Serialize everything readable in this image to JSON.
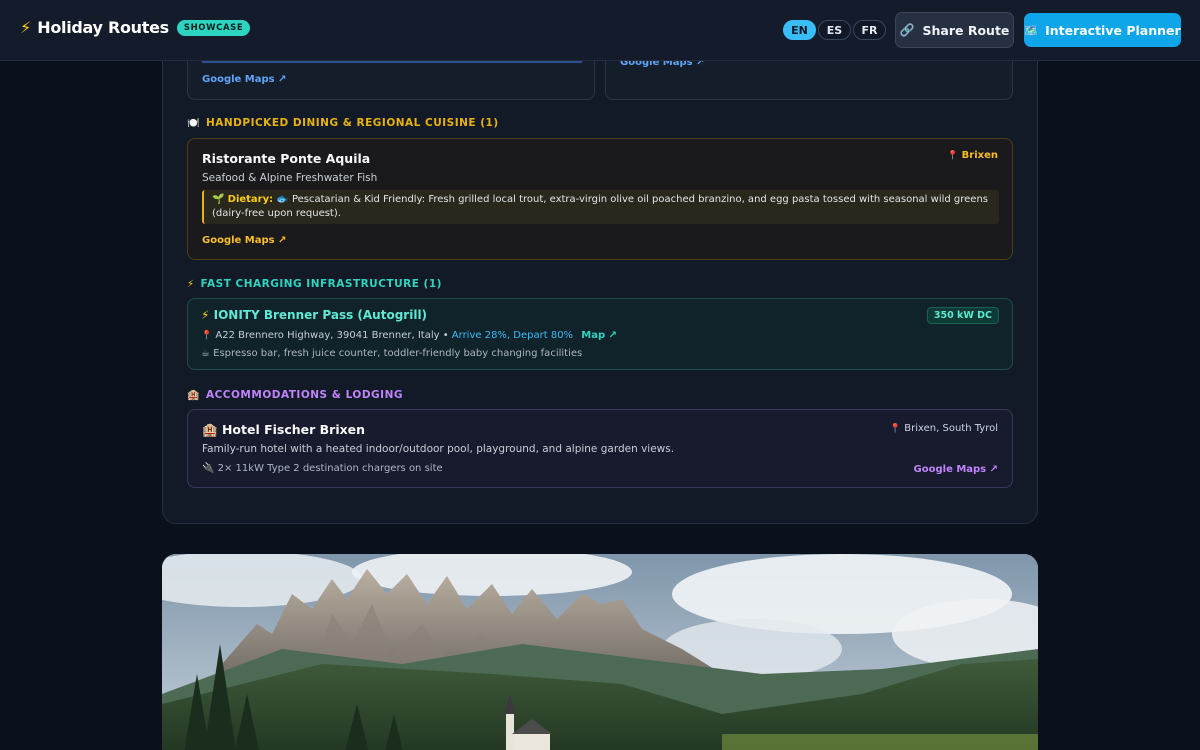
{
  "header": {
    "brand": "Holiday Routes",
    "badge": "SHOWCASE",
    "languages": [
      "EN",
      "ES",
      "FR"
    ],
    "active_language": "EN",
    "share_label": "Share Route",
    "planner_label": "Interactive Planner"
  },
  "top_cards": {
    "left_link": "Google Maps ↗",
    "right_link": "Google Maps ↗"
  },
  "dining": {
    "section_title": "HANDPICKED DINING & REGIONAL CUISINE (1)",
    "name": "Ristorante Ponte Aquila",
    "location": "Brixen",
    "cuisine": "Seafood & Alpine Freshwater Fish",
    "dietary_label": "Dietary:",
    "dietary_text": "Pescatarian & Kid Friendly: Fresh grilled local trout, extra-virgin olive oil poached branzino, and egg pasta tossed with seasonal wild greens (dairy-free upon request).",
    "maps_link": "Google Maps ↗"
  },
  "charging": {
    "section_title": "FAST CHARGING INFRASTRUCTURE (1)",
    "name": "IONITY Brenner Pass (Autogrill)",
    "power": "350 kW DC",
    "address": "A22 Brennero Highway, 39041 Brenner, Italy •",
    "soc": "Arrive 28%, Depart 80%",
    "map_link": "Map ↗",
    "amenities": "Espresso bar, fresh juice counter, toddler-friendly baby changing facilities"
  },
  "lodging": {
    "section_title": "ACCOMMODATIONS & LODGING",
    "name": "Hotel Fischer Brixen",
    "location": "Brixen, South Tyrol",
    "description": "Family-run hotel with a heated indoor/outdoor pool, playground, and alpine garden views.",
    "chargers": "2× 11kW Type 2 destination chargers on site",
    "maps_link": "Google Maps ↗"
  },
  "colors": {
    "accent_blue": "#38bdf8",
    "dining_gold": "#eab308",
    "charging_teal": "#2dd4bf",
    "lodging_purple": "#c084fc"
  },
  "icons": {
    "brand": "lightning-bolt-icon",
    "share": "link-icon",
    "planner": "map-icon",
    "dining": "plate-icon",
    "charging": "lightning-bolt-icon",
    "lodging": "hotel-icon",
    "pin": "map-pin-icon",
    "dietary": "sprout-icon",
    "amenities": "coffee-icon",
    "charger": "plug-icon"
  }
}
